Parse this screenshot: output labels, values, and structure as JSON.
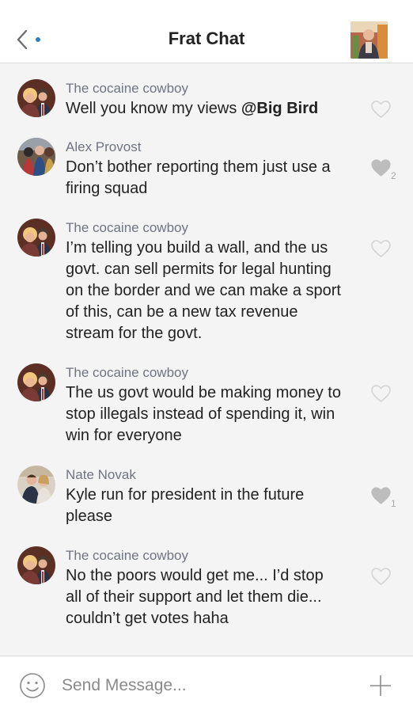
{
  "header": {
    "title": "Frat Chat",
    "icons": {
      "back": "chevron-left-icon",
      "unread_dot": "dot-icon",
      "group_avatar": "avatar"
    }
  },
  "colors": {
    "accent": "#2f7fbf",
    "heart_outline": "#d4d4d4",
    "heart_filled": "#bdbdbd",
    "sender": "#6f7480"
  },
  "messages": [
    {
      "sender": "The cocaine cowboy",
      "text_before_mention": "Well you know my views ",
      "mention": "@Big Bird",
      "liked": false,
      "likes": ""
    },
    {
      "sender": "Alex Provost",
      "text_lines": [
        "Don’t bother reporting them just use a",
        "firing squad"
      ],
      "liked": true,
      "likes": "2"
    },
    {
      "sender": "The cocaine cowboy",
      "text_lines": [
        "I’m telling you build a wall, and the us",
        "govt. can sell permits for legal hunting",
        "on the border and we can make a sport",
        "of this, can be a new tax revenue",
        "stream for the govt."
      ],
      "liked": false,
      "likes": ""
    },
    {
      "sender": "The cocaine cowboy",
      "text_lines": [
        "The us govt would be making money to",
        "stop illegals instead of spending it, win",
        "win for everyone"
      ],
      "liked": false,
      "likes": ""
    },
    {
      "sender": "Nate Novak",
      "text_lines": [
        "Kyle run for president in the future",
        "please"
      ],
      "liked": true,
      "likes": "1"
    },
    {
      "sender": "The cocaine cowboy",
      "text_lines": [
        "No the poors would get me... I’d stop",
        "all of their support and let them die...",
        "couldn’t get votes haha"
      ],
      "liked": false,
      "likes": ""
    }
  ],
  "composer": {
    "placeholder": "Send Message...",
    "value": "",
    "icons": {
      "emoji": "smiley-icon",
      "add": "plus-icon"
    }
  }
}
